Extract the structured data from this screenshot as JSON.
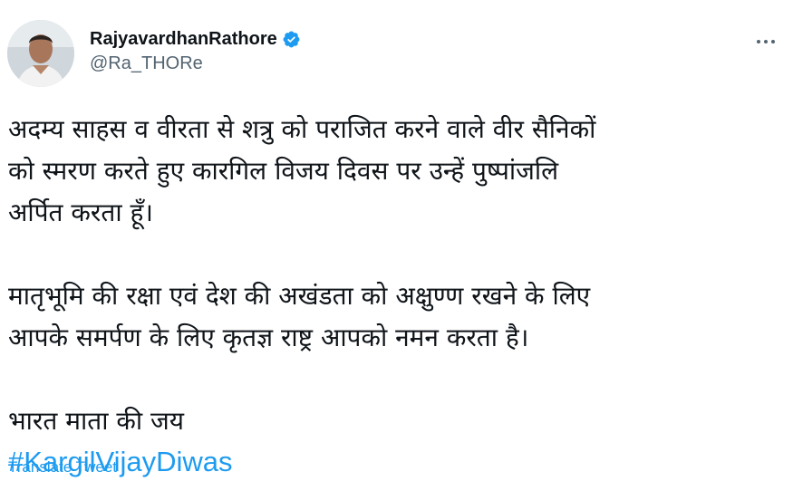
{
  "tweet": {
    "author": {
      "display_name": "RajyavardhanRathore",
      "handle": "@Ra_THORe",
      "verified": true,
      "avatar_icon": "profile-photo"
    },
    "more_icon": "more-horizontal-icon",
    "paragraph1": [
      "अदम्य साहस व वीरता से शत्रु को पराजित करने वाले वीर सैनिकों",
      "को स्मरण करते हुए कारगिल विजय दिवस पर उन्हें पुष्पांजलि",
      "अर्पित करता हूँ।"
    ],
    "paragraph2": [
      "मातृभूमि की रक्षा एवं देश की अखंडता को अक्षुण्ण रखने के लिए",
      "आपके समर्पण के लिए कृतज्ञ राष्ट्र आपको नमन करता है।"
    ],
    "paragraph3": "भारत माता की जय",
    "hashtag": "#KargilVijayDiwas",
    "translate_label": "Translate Tweet"
  },
  "colors": {
    "link": "#1d9bf0",
    "secondary_text": "#536471",
    "primary_text": "#0f1419",
    "verified_badge": "#1d9bf0"
  }
}
